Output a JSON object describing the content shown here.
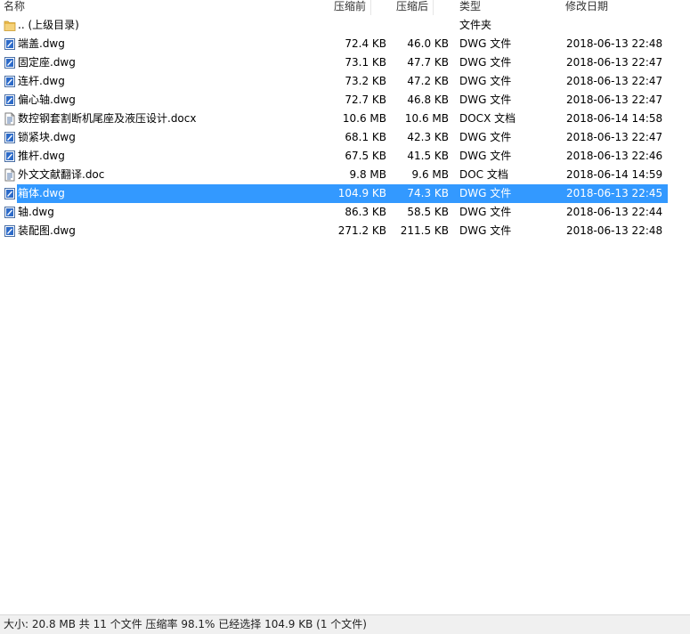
{
  "columns": {
    "name": "名称",
    "size_before": "压缩前",
    "size_after": "压缩后",
    "type": "类型",
    "modified": "修改日期"
  },
  "files": [
    {
      "icon": "folder-icon",
      "name": ".. (上级目录)",
      "before": "",
      "after": "",
      "type": "文件夹",
      "date": "",
      "selected": false
    },
    {
      "icon": "dwg-file-icon",
      "name": "端盖.dwg",
      "before": "72.4 KB",
      "after": "46.0 KB",
      "type": "DWG 文件",
      "date": "2018-06-13 22:48",
      "selected": false
    },
    {
      "icon": "dwg-file-icon",
      "name": "固定座.dwg",
      "before": "73.1 KB",
      "after": "47.7 KB",
      "type": "DWG 文件",
      "date": "2018-06-13 22:47",
      "selected": false
    },
    {
      "icon": "dwg-file-icon",
      "name": "连杆.dwg",
      "before": "73.2 KB",
      "after": "47.2 KB",
      "type": "DWG 文件",
      "date": "2018-06-13 22:47",
      "selected": false
    },
    {
      "icon": "dwg-file-icon",
      "name": "偏心轴.dwg",
      "before": "72.7 KB",
      "after": "46.8 KB",
      "type": "DWG 文件",
      "date": "2018-06-13 22:47",
      "selected": false
    },
    {
      "icon": "doc-file-icon",
      "name": "数控钢套割断机尾座及液压设计.docx",
      "before": "10.6 MB",
      "after": "10.6 MB",
      "type": "DOCX 文档",
      "date": "2018-06-14 14:58",
      "selected": false
    },
    {
      "icon": "dwg-file-icon",
      "name": "锁紧块.dwg",
      "before": "68.1 KB",
      "after": "42.3 KB",
      "type": "DWG 文件",
      "date": "2018-06-13 22:47",
      "selected": false
    },
    {
      "icon": "dwg-file-icon",
      "name": "推杆.dwg",
      "before": "67.5 KB",
      "after": "41.5 KB",
      "type": "DWG 文件",
      "date": "2018-06-13 22:46",
      "selected": false
    },
    {
      "icon": "doc-file-icon",
      "name": "外文文献翻译.doc",
      "before": "9.8 MB",
      "after": "9.6 MB",
      "type": "DOC 文档",
      "date": "2018-06-14 14:59",
      "selected": false
    },
    {
      "icon": "dwg-file-icon",
      "name": "箱体.dwg",
      "before": "104.9 KB",
      "after": "74.3 KB",
      "type": "DWG 文件",
      "date": "2018-06-13 22:45",
      "selected": true
    },
    {
      "icon": "dwg-file-icon",
      "name": "轴.dwg",
      "before": "86.3 KB",
      "after": "58.5 KB",
      "type": "DWG 文件",
      "date": "2018-06-13 22:44",
      "selected": false
    },
    {
      "icon": "dwg-file-icon",
      "name": "装配图.dwg",
      "before": "271.2 KB",
      "after": "211.5 KB",
      "type": "DWG 文件",
      "date": "2018-06-13 22:48",
      "selected": false
    }
  ],
  "status": "大小: 20.8 MB 共 11 个文件 压缩率 98.1% 已经选择 104.9 KB (1 个文件)",
  "colors": {
    "selection": "#3399ff",
    "statusbar": "#f0f0f0",
    "folder": "#e8b84a"
  }
}
